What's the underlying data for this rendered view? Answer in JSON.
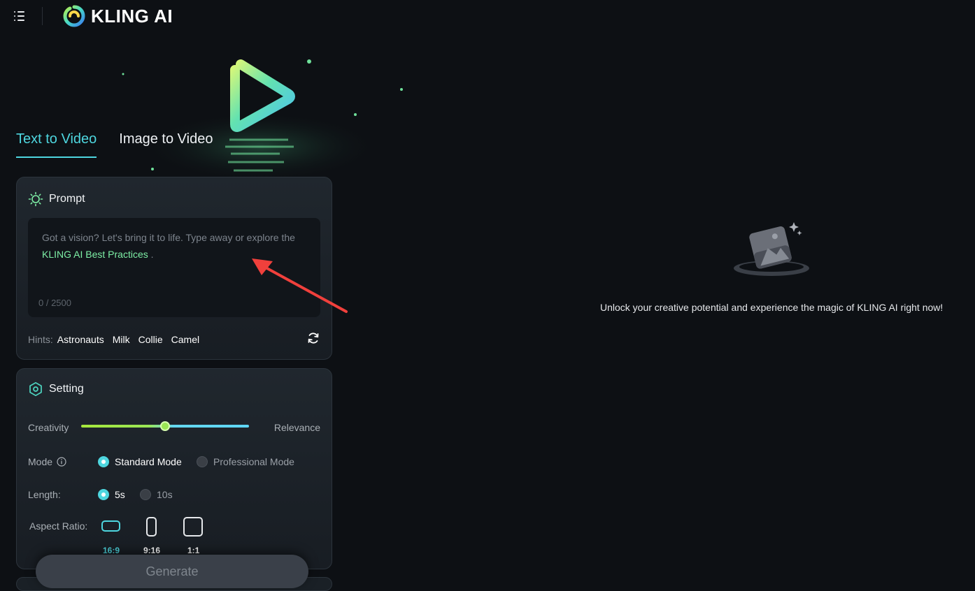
{
  "app": {
    "logo_text": "KLING AI"
  },
  "tabs": [
    {
      "label": "Text to Video",
      "active": true
    },
    {
      "label": "Image to Video",
      "active": false
    }
  ],
  "prompt": {
    "title": "Prompt",
    "placeholder_text": "Got a vision? Let's bring it to life. Type away or explore the",
    "placeholder_link": "KLING AI Best Practices",
    "placeholder_suffix": ".",
    "counter": "0 / 2500",
    "hints_label": "Hints:",
    "hints": [
      "Astronauts",
      "Milk",
      "Collie",
      "Camel"
    ]
  },
  "setting": {
    "title": "Setting",
    "slider_left_label": "Creativity",
    "slider_right_label": "Relevance",
    "slider_value": 0.5,
    "mode_label": "Mode",
    "modes": [
      {
        "label": "Standard Mode",
        "selected": true
      },
      {
        "label": "Professional Mode",
        "selected": false
      }
    ],
    "length_label": "Length:",
    "lengths": [
      {
        "label": "5s",
        "selected": true
      },
      {
        "label": "10s",
        "selected": false
      }
    ],
    "aspect_label": "Aspect Ratio:",
    "aspects": [
      {
        "label": "16:9",
        "selected": true
      },
      {
        "label": "9:16",
        "selected": false
      },
      {
        "label": "1:1",
        "selected": false
      }
    ]
  },
  "generate_label": "Generate",
  "empty_state": {
    "message": "Unlock your creative potential and experience the magic of KLING AI right now!"
  },
  "colors": {
    "accent": "#4ed6df",
    "link": "#7ef0a6",
    "annotation_arrow": "#f0403c"
  }
}
